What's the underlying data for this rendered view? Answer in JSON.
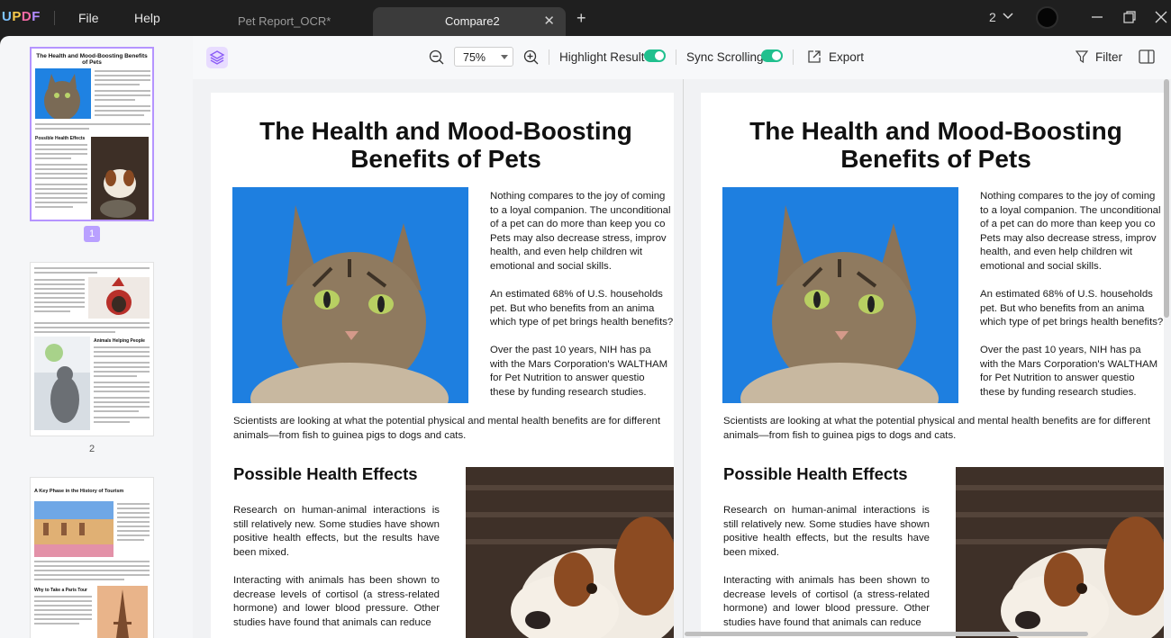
{
  "app": {
    "logo": "UPDF",
    "menu": [
      "File",
      "Help"
    ],
    "tabs": [
      {
        "label": "Pet Report_OCR*",
        "active": false
      },
      {
        "label": "Compare2",
        "active": true
      }
    ],
    "window_count": "2"
  },
  "sidebar": {
    "selected_page": "1",
    "pages": [
      "1",
      "2"
    ],
    "thumb1": {
      "title": "The Health and Mood-Boosting Benefits of Pets",
      "section": "Possible Health Effects"
    },
    "thumb2": {
      "section": "Animals Helping People"
    },
    "thumb3": {
      "title": "A Key Phase in the History of Tourism",
      "section": "Why to Take a Paris Tour"
    }
  },
  "toolbar": {
    "zoom": "75%",
    "highlight_label": "Highlight Result",
    "highlight_on": true,
    "sync_label": "Sync Scrolling",
    "sync_on": true,
    "export_label": "Export",
    "filter_label": "Filter",
    "accent_color": "#20c08e"
  },
  "document": {
    "title_line1": "The Health and Mood-Boosting",
    "title_line2": "Benefits of Pets",
    "right_col": [
      [
        "Nothing compares to the joy of coming",
        "to a loyal companion. The unconditional",
        "of a pet can do more than keep you co",
        "Pets may also decrease stress, improv",
        "health, and even help children wit",
        "emotional and social skills."
      ],
      [
        "An estimated 68% of U.S. households",
        "pet. But who benefits from an anima",
        "which type of pet brings health benefits?"
      ],
      [
        "Over the past 10 years, NIH has pa",
        "with the Mars Corporation's WALTHAM",
        "for Pet Nutrition to answer questio",
        "these by funding research studies."
      ]
    ],
    "caption": "Scientists are looking at what the potential physical and mental health benefits are for different animals—from fish to guinea pigs to dogs and cats.",
    "section_heading": "Possible Health Effects",
    "para1": "Research on human-animal interactions is still relatively new. Some studies have shown positive health effects, but the results have been mixed.",
    "para2": "Interacting with animals has been shown to decrease levels of cortisol (a stress-related hormone) and lower blood pressure. Other studies have found that animals can reduce"
  }
}
